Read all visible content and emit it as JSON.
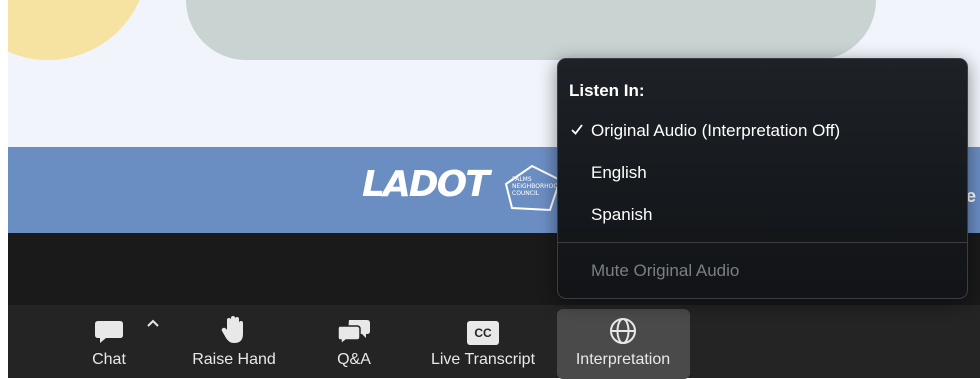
{
  "slide": {
    "logo_text": "LADOT",
    "council_text": [
      "PALMS",
      "NEIGHBORHOOD",
      "COUNCIL"
    ],
    "cut_text": "e"
  },
  "toolbar": {
    "items": [
      {
        "label": "Chat",
        "icon": "chat-bubble-icon"
      },
      {
        "label": "Raise Hand",
        "icon": "hand-icon"
      },
      {
        "label": "Q&A",
        "icon": "qa-bubbles-icon"
      },
      {
        "label": "Live Transcript",
        "icon": "cc-icon",
        "icon_text": "CC"
      },
      {
        "label": "Interpretation",
        "icon": "globe-icon",
        "active": true
      }
    ]
  },
  "menu": {
    "heading": "Listen In:",
    "options": [
      {
        "label": "Original Audio (Interpretation Off)",
        "checked": true
      },
      {
        "label": "English",
        "checked": false
      },
      {
        "label": "Spanish",
        "checked": false
      }
    ],
    "mute_label": "Mute Original Audio"
  },
  "colors": {
    "toolbar_bg": "#242424",
    "active_bg": "#4a4a4a",
    "menu_bg": "#1a1d21",
    "band_blue": "#6b8ec2"
  }
}
